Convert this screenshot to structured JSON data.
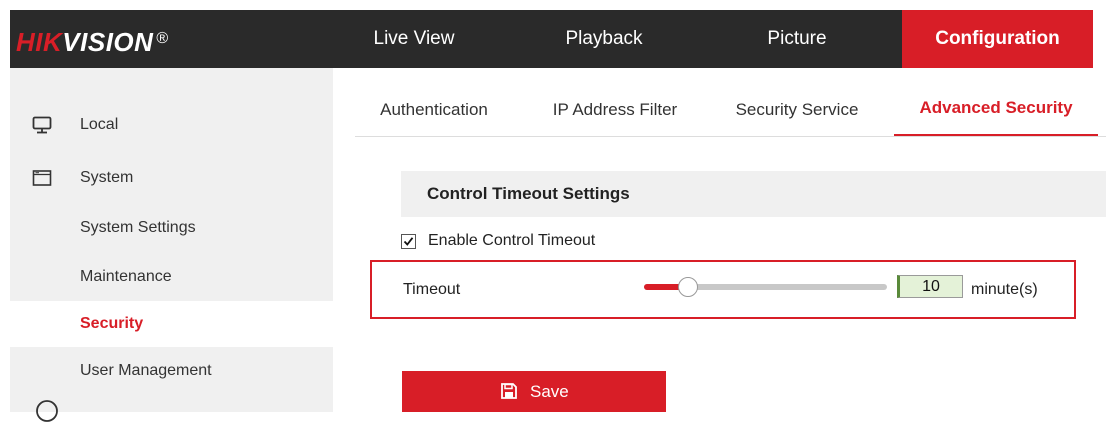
{
  "logo": {
    "part1": "HIK",
    "part2": "VISION",
    "mark": "®"
  },
  "nav": [
    {
      "label": "Live View",
      "active": false
    },
    {
      "label": "Playback",
      "active": false
    },
    {
      "label": "Picture",
      "active": false
    },
    {
      "label": "Configuration",
      "active": true
    }
  ],
  "sidebar": {
    "items": [
      {
        "label": "Local",
        "icon": "monitor-icon"
      },
      {
        "label": "System",
        "icon": "window-icon"
      },
      {
        "label": "System Settings"
      },
      {
        "label": "Maintenance"
      },
      {
        "label": "Security",
        "active": true
      },
      {
        "label": "User Management"
      }
    ]
  },
  "tabs": [
    {
      "label": "Authentication"
    },
    {
      "label": "IP Address Filter"
    },
    {
      "label": "Security Service"
    },
    {
      "label": "Advanced Security",
      "active": true
    }
  ],
  "section": {
    "title": "Control Timeout Settings"
  },
  "enable_timeout": {
    "label": "Enable Control Timeout",
    "checked": true
  },
  "timeout": {
    "label": "Timeout",
    "value": "10",
    "unit": "minute(s)",
    "slider_fraction": 0.18
  },
  "save": {
    "label": "Save",
    "icon": "floppy-disk-icon"
  },
  "colors": {
    "accent": "#d81e27",
    "topbar": "#2a2a2a",
    "sidebar": "#f0f0f0"
  }
}
